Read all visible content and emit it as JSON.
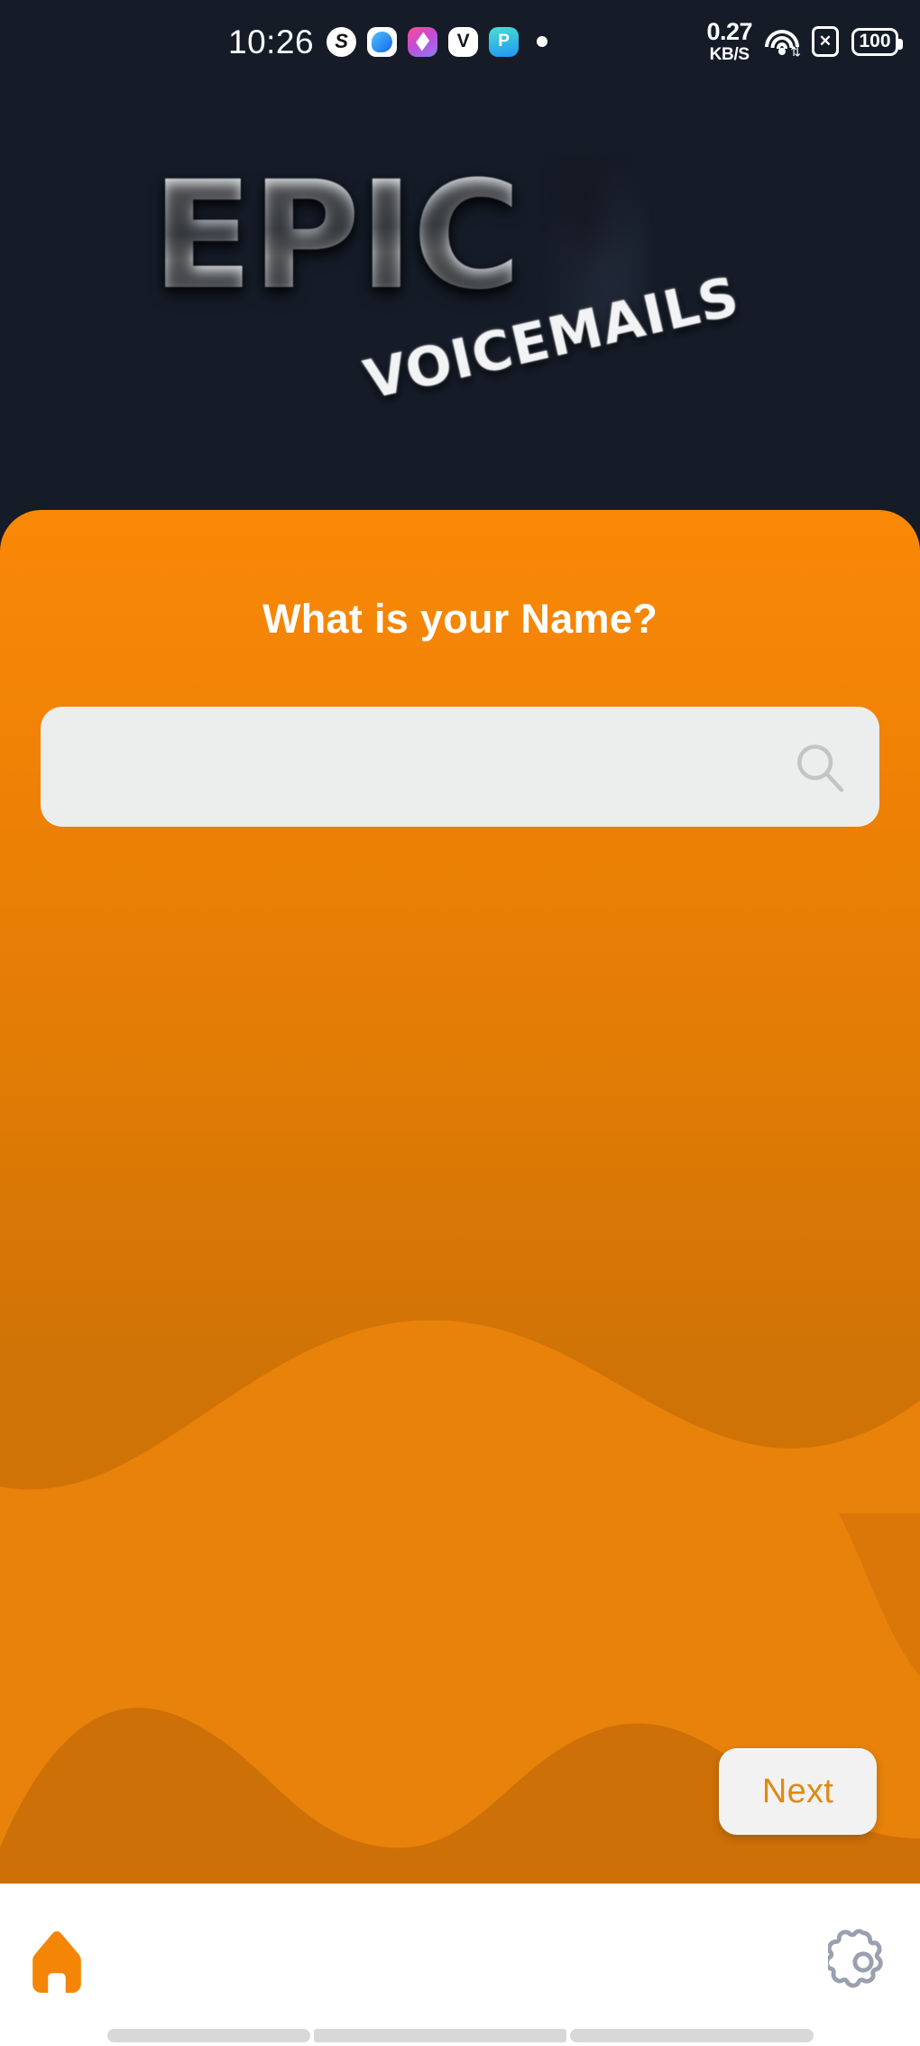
{
  "status_bar": {
    "clock": "10:26",
    "app_icons": [
      {
        "name": "skype-icon",
        "glyph": "S"
      },
      {
        "name": "messenger-icon",
        "glyph": ""
      },
      {
        "name": "photo-editor-icon",
        "glyph": ""
      },
      {
        "name": "vimeo-icon",
        "glyph": "V"
      },
      {
        "name": "finance-app-icon",
        "glyph": "P"
      }
    ],
    "network_speed_value": "0.27",
    "network_speed_unit": "KB/S",
    "wifi_label": "wifi-icon",
    "sim_label": "sim-card-disabled-icon",
    "battery_level": "100"
  },
  "logo": {
    "primary": "EPIC",
    "secondary": "VOICEMAILS"
  },
  "card": {
    "question": "What is your Name?",
    "search": {
      "value": "",
      "placeholder": ""
    },
    "next_label": "Next"
  },
  "bottom_nav": {
    "home_label": "Home",
    "settings_label": "Settings"
  },
  "colors": {
    "background": "#151c28",
    "card_top": "#f98806",
    "card_bottom": "#cf7206",
    "wave_light": "#e8820a",
    "wave_dark": "#cd7008",
    "accent_text": "#e08a12",
    "nav_active": "#f58505",
    "nav_inactive": "#9aa0ae"
  }
}
